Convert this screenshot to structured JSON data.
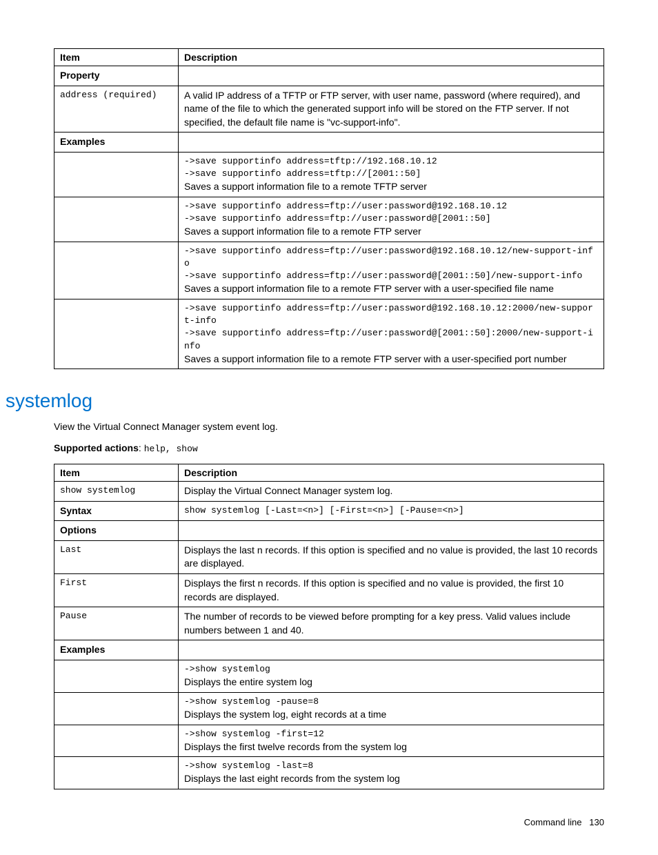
{
  "table1": {
    "header_item": "Item",
    "header_desc": "Description",
    "property_label": "Property",
    "address_item": "address (required)",
    "address_desc": "A valid IP address of a TFTP or FTP server, with user name, password (where required), and name of the file to which the generated support info will be stored on the FTP server. If not specified, the default file name is \"vc-support-info\".",
    "examples_label": "Examples",
    "ex1_code1": "->save supportinfo address=tftp://192.168.10.12",
    "ex1_code2": "->save supportinfo address=tftp://[2001::50]",
    "ex1_desc": "Saves a support information file to a remote TFTP server",
    "ex2_code1": "->save supportinfo address=ftp://user:password@192.168.10.12",
    "ex2_code2": "->save supportinfo address=ftp://user:password@[2001::50]",
    "ex2_desc": "Saves a support information file to a remote FTP server",
    "ex3_code1": "->save supportinfo address=ftp://user:password@192.168.10.12/new-support-info",
    "ex3_code2": "->save supportinfo address=ftp://user:password@[2001::50]/new-support-info",
    "ex3_desc": "Saves a support information file to a remote FTP server with a user-specified file name",
    "ex4_code1": "->save supportinfo address=ftp://user:password@192.168.10.12:2000/new-support-info",
    "ex4_code2": "->save supportinfo address=ftp://user:password@[2001::50]:2000/new-support-info",
    "ex4_desc": "Saves a support information file to a remote FTP server with a user-specified port number"
  },
  "section": {
    "heading": "systemlog",
    "intro": "View the Virtual Connect Manager system event log.",
    "supported_label": "Supported actions",
    "supported_value": "help, show"
  },
  "table2": {
    "header_item": "Item",
    "header_desc": "Description",
    "show_item": "show systemlog",
    "show_desc": "Display the Virtual Connect Manager system log.",
    "syntax_label": "Syntax",
    "syntax_value": "show systemlog [-Last=<n>] [-First=<n>] [-Pause=<n>]",
    "options_label": "Options",
    "last_item": "Last",
    "last_desc": "Displays the last n records. If this option is specified and no value is provided, the last 10 records are displayed.",
    "first_item": "First",
    "first_desc": "Displays the first n records. If this option is specified and no value is provided, the first 10 records are displayed.",
    "pause_item": "Pause",
    "pause_desc": "The number of records to be viewed before prompting for a key press. Valid values include numbers between 1 and 40.",
    "examples_label": "Examples",
    "ex1_code": "->show systemlog",
    "ex1_desc": "Displays the entire system log",
    "ex2_code": "->show systemlog -pause=8",
    "ex2_desc": "Displays the system log, eight records at a time",
    "ex3_code": "->show systemlog -first=12",
    "ex3_desc": "Displays the first twelve records from the system log",
    "ex4_code": "->show systemlog -last=8",
    "ex4_desc": "Displays the last eight records from the system log"
  },
  "footer": {
    "text": "Command line",
    "page": "130"
  }
}
